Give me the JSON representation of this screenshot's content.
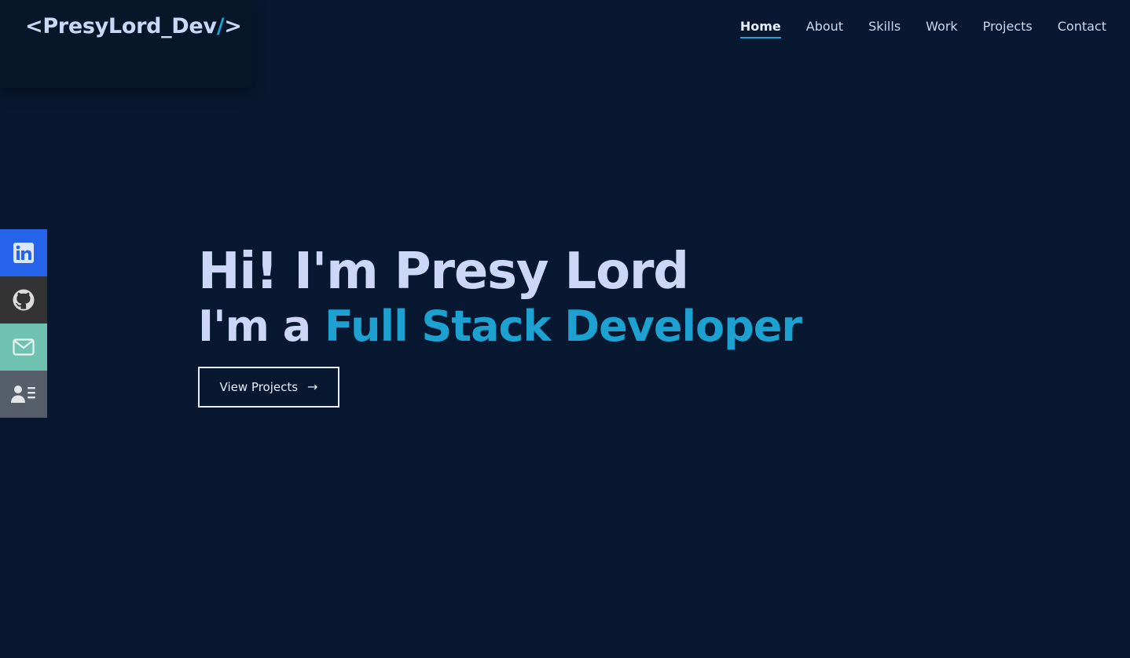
{
  "header": {
    "logo": {
      "prefix": "<PresyLord_Dev",
      "slash": "/",
      "suffix": ">"
    },
    "nav": [
      {
        "label": "Home",
        "active": true
      },
      {
        "label": "About",
        "active": false
      },
      {
        "label": "Skills",
        "active": false
      },
      {
        "label": "Work",
        "active": false
      },
      {
        "label": "Projects",
        "active": false
      },
      {
        "label": "Contact",
        "active": false
      }
    ]
  },
  "social": [
    {
      "icon": "linkedin-icon",
      "color": "#2563eb"
    },
    {
      "icon": "github-icon",
      "color": "#333333"
    },
    {
      "icon": "mail-icon",
      "color": "#6fc2b0"
    },
    {
      "icon": "resume-icon",
      "color": "#565f69"
    }
  ],
  "hero": {
    "line1": "Hi! I'm Presy Lord",
    "line2_prefix": "I'm a ",
    "line2_accent": "Full Stack Developer",
    "cta_label": "View Projects",
    "cta_arrow": "→"
  },
  "colors": {
    "background": "#081830",
    "accent": "#1ca1d1",
    "text": "#ccd6f6"
  }
}
